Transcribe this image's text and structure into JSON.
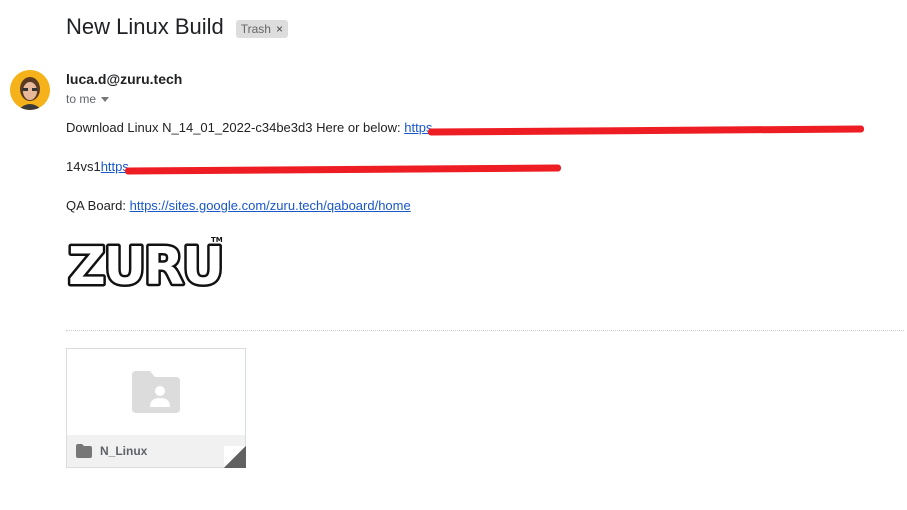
{
  "email": {
    "subject": "New Linux Build",
    "label": "Trash",
    "sender": "luca.d@zuru.tech",
    "recipient": "to me",
    "line1_text": "Download Linux N_14_01_2022-c34be3d3 Here or below:",
    "line1_link_visible": "https",
    "line2_text": "14vs1",
    "line2_link_visible": "https",
    "line3_text": "QA Board:",
    "line3_link": "https://sites.google.com/zuru.tech/qaboard/home",
    "logo_text": "ZURU",
    "logo_tm": "TM"
  },
  "attachment": {
    "name": "N_Linux",
    "icon": "shared-folder-icon",
    "small_icon": "folder-icon"
  },
  "colors": {
    "link": "#1a57c9",
    "redaction": "#ee1d23",
    "avatar_bg": "#f6b21a"
  }
}
